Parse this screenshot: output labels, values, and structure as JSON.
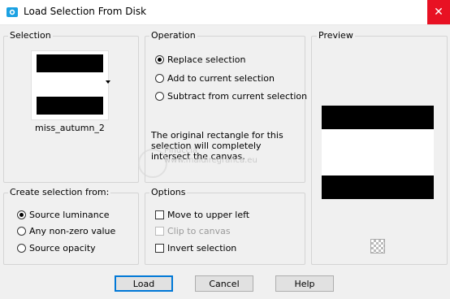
{
  "window": {
    "title": "Load Selection From Disk",
    "close_glyph": "✕"
  },
  "selection": {
    "label": "Selection",
    "name": "miss_autumn_2"
  },
  "operation": {
    "label": "Operation",
    "options": [
      {
        "label": "Replace selection",
        "selected": true
      },
      {
        "label": "Add to current selection",
        "selected": false
      },
      {
        "label": "Subtract from current selection",
        "selected": false
      }
    ],
    "info": "The original rectangle for this selection will completely intersect the canvas."
  },
  "preview": {
    "label": "Preview"
  },
  "create_from": {
    "label": "Create selection from:",
    "options": [
      {
        "label": "Source luminance",
        "selected": true
      },
      {
        "label": "Any non-zero value",
        "selected": false
      },
      {
        "label": "Source opacity",
        "selected": false
      }
    ]
  },
  "options": {
    "label": "Options",
    "items": [
      {
        "label": "Move to upper left",
        "checked": false,
        "enabled": true
      },
      {
        "label": "Clip to canvas",
        "checked": false,
        "enabled": false
      },
      {
        "label": "Invert selection",
        "checked": false,
        "enabled": true
      }
    ]
  },
  "buttons": {
    "load": "Load",
    "cancel": "Cancel",
    "help": "Help"
  },
  "watermark": {
    "line1": "Pinuccia",
    "line2": "www.maidiregrafica.eu"
  },
  "colors": {
    "close": "#e81123",
    "accent": "#0078d7",
    "icon": "#1ba1e2"
  }
}
